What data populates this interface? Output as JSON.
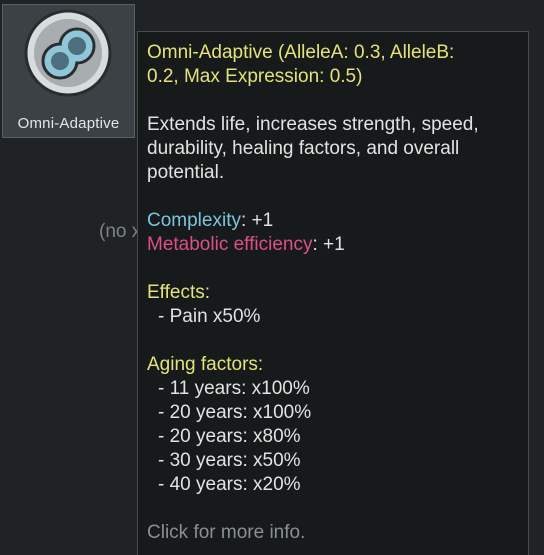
{
  "gene": {
    "label": "Omni-Adaptive"
  },
  "background": {
    "text": "(no x"
  },
  "tooltip": {
    "title_line1": "Omni-Adaptive (AlleleA: 0.3, AlleleB:",
    "title_line2": "0.2, Max Expression: 0.5)",
    "desc_line1": "Extends life, increases strength, speed,",
    "desc_line2": "durability, healing factors, and overall",
    "desc_line3": "potential.",
    "complexity_label": "Complexity",
    "complexity_value": ": +1",
    "metabolic_label": "Metabolic efficiency",
    "metabolic_value": ": +1",
    "effects_header": "Effects:",
    "effects": [
      "- Pain x50%"
    ],
    "aging_header": "Aging factors:",
    "aging": [
      "- 11 years: x100%",
      "- 20 years: x100%",
      "- 20 years: x80%",
      "- 30 years: x50%",
      "- 40 years: x20%"
    ],
    "footer": "Click for more info."
  },
  "colors": {
    "title": "#e6e27a",
    "complexity": "#7fc4dd",
    "metabolic": "#dc4f87",
    "footer": "#8a8f92"
  },
  "icons": {
    "gene": "double-cell-gene-icon"
  }
}
